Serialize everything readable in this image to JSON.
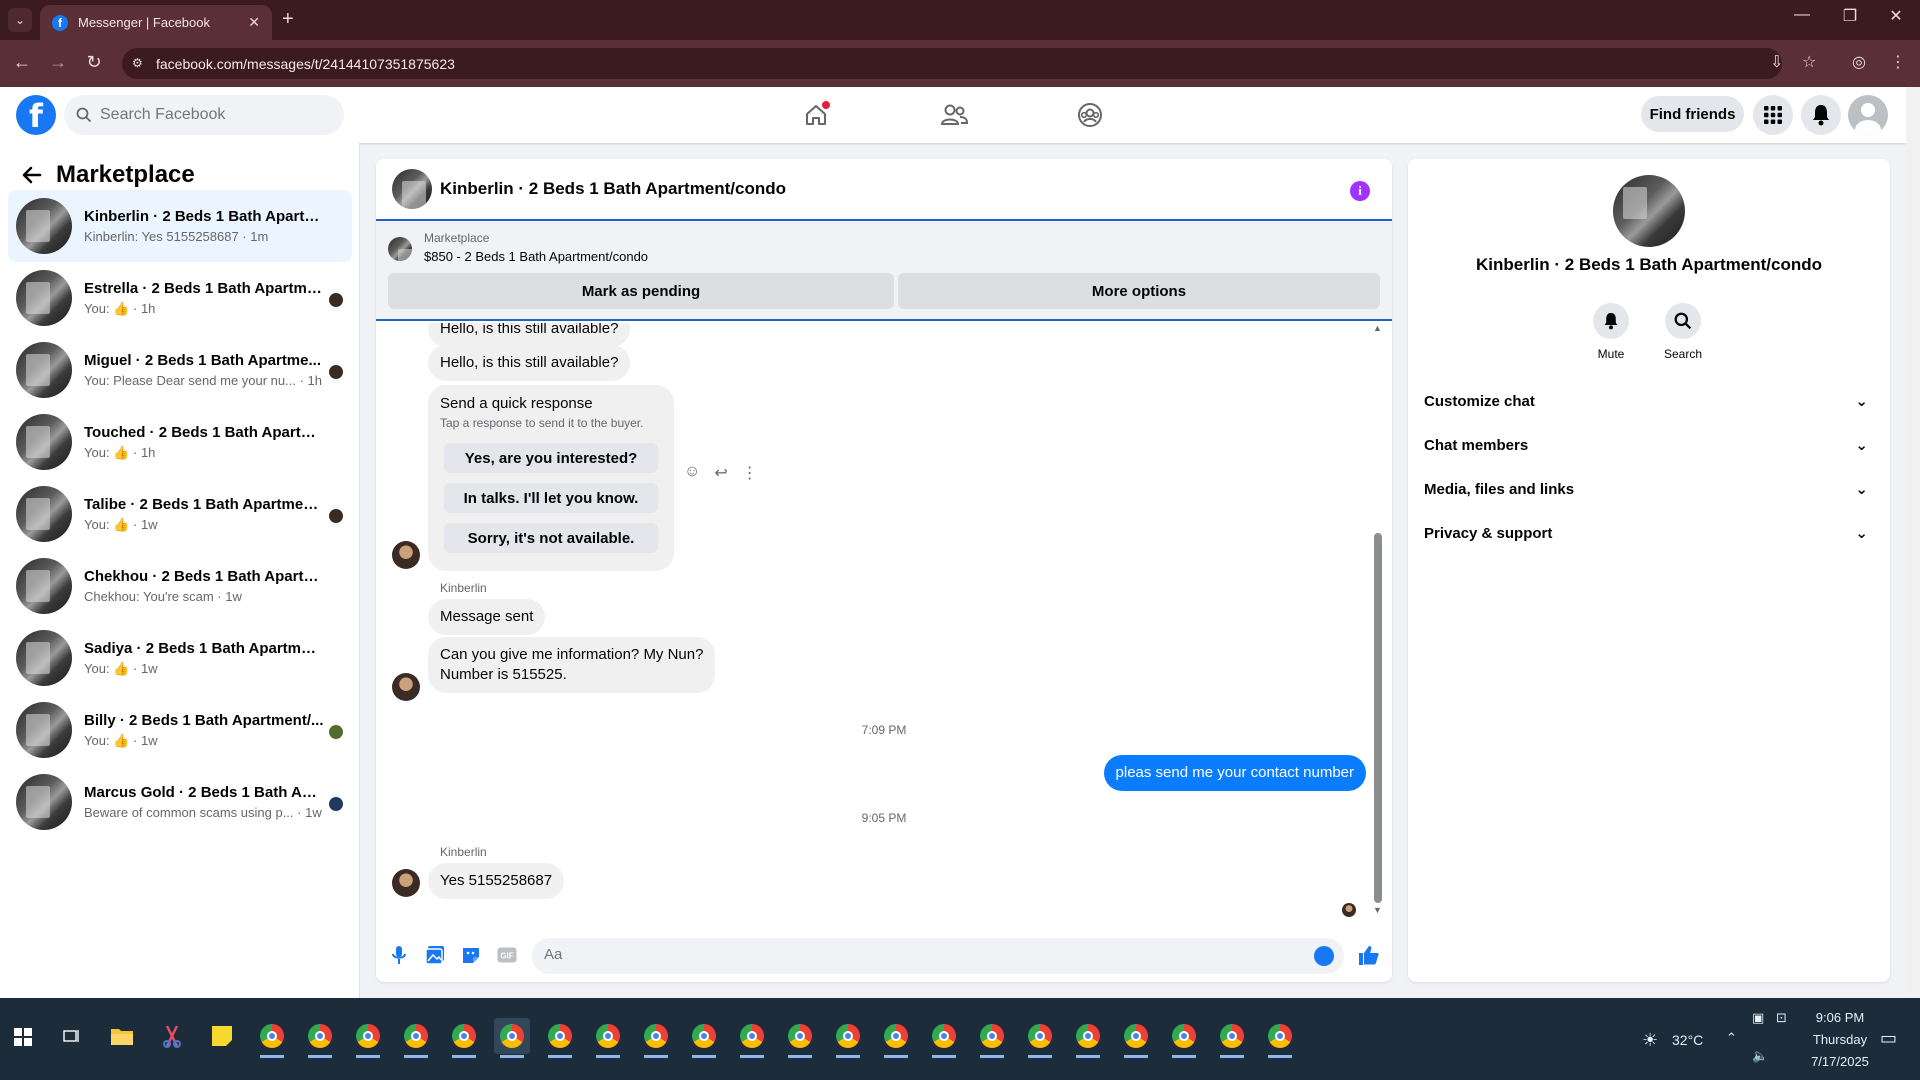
{
  "browser": {
    "tab_title": "Messenger | Facebook",
    "url": "facebook.com/messages/t/24144107351875623"
  },
  "fb": {
    "search_placeholder": "Search Facebook",
    "find_friends": "Find friends"
  },
  "sidebar": {
    "title": "Marketplace",
    "conversations": [
      {
        "name": "Kinberlin · 2 Beds 1 Bath Apartmen...",
        "preview": "Kinberlin: Yes 5155258687 · 1m",
        "active": true
      },
      {
        "name": "Estrella · 2 Beds 1 Bath Apartme...",
        "preview_prefix": "You:",
        "preview_suffix": "· 1h"
      },
      {
        "name": "Miguel · 2 Beds 1 Bath Apartme...",
        "preview": "You: Please Dear send me your nu... · 1h"
      },
      {
        "name": "Touched · 2 Beds 1 Bath Apartmen...",
        "preview_prefix": "You:",
        "preview_suffix": "· 1h"
      },
      {
        "name": "Talibe · 2 Beds 1 Bath Apartment...",
        "preview_prefix": "You:",
        "preview_suffix": "· 1w"
      },
      {
        "name": "Chekhou · 2 Beds 1 Bath Apartmen...",
        "preview": "Chekhou: You're scam · 1w"
      },
      {
        "name": "Sadiya · 2 Beds 1 Bath Apartment/...",
        "preview_prefix": "You:",
        "preview_suffix": "· 1w"
      },
      {
        "name": "Billy · 2 Beds 1 Bath Apartment/...",
        "preview_prefix": "You:",
        "preview_suffix": "· 1w"
      },
      {
        "name": "Marcus Gold · 2 Beds 1 Bath Apa...",
        "preview": "Beware of common scams using p... · 1w"
      }
    ]
  },
  "chat": {
    "title": "Kinberlin · 2 Beds 1 Bath Apartment/condo",
    "marketplace_label": "Marketplace",
    "listing": "$850 - 2 Beds 1 Bath Apartment/condo",
    "mark_pending": "Mark as pending",
    "more_options": "More options",
    "msg_partial": "Hello, is this still available?",
    "msg_available": "Hello, is this still available?",
    "quick_title": "Send a quick response",
    "quick_sub": "Tap a response to send it to the buyer.",
    "quick_options": [
      "Yes, are you interested?",
      "In talks. I'll let you know.",
      "Sorry, it's not available."
    ],
    "sender_1": "Kinberlin",
    "msg_sent": "Message sent",
    "msg_info_1": "Can you give me information? My Nun?",
    "msg_info_2": "Number is 515525.",
    "time_1": "7:09 PM",
    "own_msg": "pleas send me your contact number",
    "time_2": "9:05 PM",
    "sender_2": "Kinberlin",
    "msg_last": "Yes 5155258687",
    "composer_placeholder": "Aa"
  },
  "info_panel": {
    "name": "Kinberlin · 2 Beds 1 Bath Apartment/condo",
    "mute": "Mute",
    "search": "Search",
    "sections": [
      "Customize chat",
      "Chat members",
      "Media, files and links",
      "Privacy & support"
    ]
  },
  "taskbar": {
    "temperature": "32°C",
    "time": "9:06 PM",
    "day": "Thursday",
    "date": "7/17/2025"
  },
  "colors": {
    "fb_blue": "#1877f2",
    "chrome_tab": "#3c1b20",
    "own_bubble": "#0a7cff",
    "info_purple": "#a033ff"
  }
}
